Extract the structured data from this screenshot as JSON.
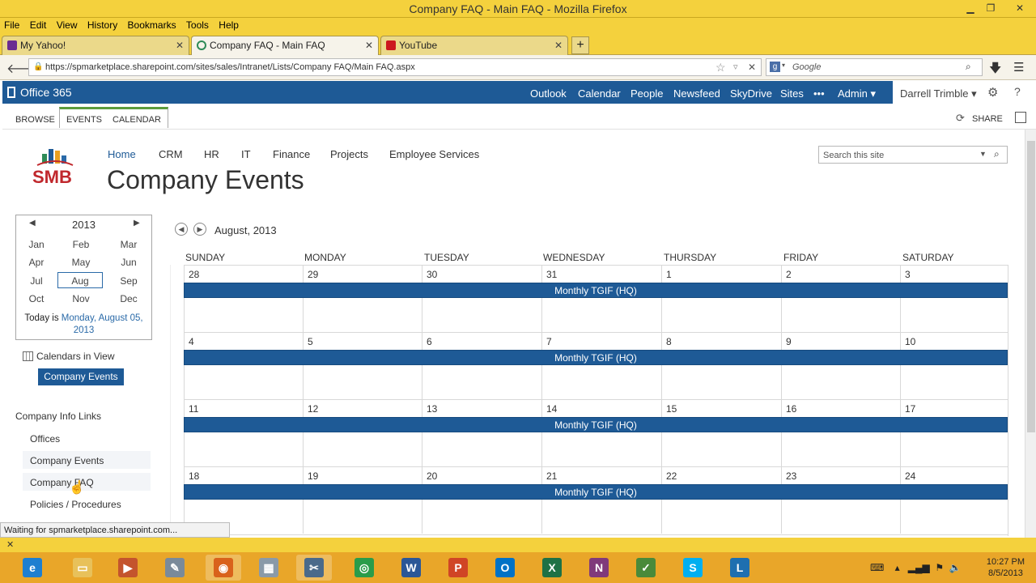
{
  "window": {
    "title": "Company FAQ - Main FAQ - Mozilla Firefox",
    "menu": [
      "File",
      "Edit",
      "View",
      "History",
      "Bookmarks",
      "Tools",
      "Help"
    ],
    "tabs": [
      {
        "label": "My Yahoo!",
        "favicon_color": "#6a2c91",
        "favicon_glyph": "Y!"
      },
      {
        "label": "Company FAQ - Main FAQ",
        "favicon_color": "#2e8b57",
        "favicon_glyph": "○"
      },
      {
        "label": "YouTube",
        "favicon_color": "#cc181e",
        "favicon_glyph": "▶"
      }
    ],
    "url": "https://spmarketplace.sharepoint.com/sites/sales/Intranet/Lists/Company FAQ/Main FAQ.aspx",
    "search_placeholder": "Google",
    "search_engine_glyph": "g"
  },
  "o365": {
    "brand": "Office 365",
    "nav": [
      "Outlook",
      "Calendar",
      "People",
      "Newsfeed",
      "SkyDrive",
      "Sites",
      "•••",
      "Admin ▾"
    ],
    "user": "Darrell Trimble ▾",
    "colors": {
      "bar": "#1e5a96",
      "accent_green": "#5c9c3c"
    }
  },
  "ribbon": {
    "tabs": [
      "BROWSE",
      "EVENTS",
      "CALENDAR"
    ],
    "share": "SHARE"
  },
  "site": {
    "logo_text": "SMB",
    "topnav": [
      "Home",
      "CRM",
      "HR",
      "IT",
      "Finance",
      "Projects",
      "Employee Services"
    ],
    "title": "Company Events",
    "search_placeholder": "Search this site"
  },
  "picker": {
    "year": "2013",
    "months": [
      "Jan",
      "Feb",
      "Mar",
      "Apr",
      "May",
      "Jun",
      "Jul",
      "Aug",
      "Sep",
      "Oct",
      "Nov",
      "Dec"
    ],
    "selected": "Aug",
    "today_prefix": "Today is",
    "today_link": "Monday, August 05,",
    "today_link2": "2013"
  },
  "calendars_in_view": {
    "label": "Calendars in View",
    "button": "Company Events"
  },
  "quicklaunch": {
    "heading": "Company Info Links",
    "items": [
      "Offices",
      "Company Events",
      "Company FAQ",
      "Policies / Procedures"
    ]
  },
  "calendar": {
    "month_label": "August, 2013",
    "days": [
      "SUNDAY",
      "MONDAY",
      "TUESDAY",
      "WEDNESDAY",
      "THURSDAY",
      "FRIDAY",
      "SATURDAY"
    ],
    "weeks": [
      [
        "28",
        "29",
        "30",
        "31",
        "1",
        "2",
        "3"
      ],
      [
        "4",
        "5",
        "6",
        "7",
        "8",
        "9",
        "10"
      ],
      [
        "11",
        "12",
        "13",
        "14",
        "15",
        "16",
        "17"
      ],
      [
        "18",
        "19",
        "20",
        "21",
        "22",
        "23",
        "24"
      ]
    ],
    "event": "Monthly TGIF (HQ)"
  },
  "status": "Waiting for spmarketplace.sharepoint.com...",
  "taskbar": {
    "apps": [
      {
        "name": "ie-icon",
        "color": "#1e7fd0",
        "glyph": "e"
      },
      {
        "name": "file-explorer-icon",
        "color": "#e8c15a",
        "glyph": "▭"
      },
      {
        "name": "media-player-icon",
        "color": "#c4542d",
        "glyph": "▶"
      },
      {
        "name": "notepad-icon",
        "color": "#7a8a9a",
        "glyph": "✎"
      },
      {
        "name": "firefox-icon",
        "color": "#d9621b",
        "glyph": "◉"
      },
      {
        "name": "calculator-icon",
        "color": "#8a9aa8",
        "glyph": "▦"
      },
      {
        "name": "snipping-tool-icon",
        "color": "#4a6a8a",
        "glyph": "✂"
      },
      {
        "name": "chrome-icon",
        "color": "#2a9c4a",
        "glyph": "◎"
      },
      {
        "name": "word-icon",
        "color": "#2b5797",
        "glyph": "W"
      },
      {
        "name": "powerpoint-icon",
        "color": "#d04525",
        "glyph": "P"
      },
      {
        "name": "outlook-icon",
        "color": "#0072c6",
        "glyph": "O"
      },
      {
        "name": "excel-icon",
        "color": "#1e7145",
        "glyph": "X"
      },
      {
        "name": "onenote-icon",
        "color": "#80397b",
        "glyph": "N"
      },
      {
        "name": "project-icon",
        "color": "#4a8a3a",
        "glyph": "✓"
      },
      {
        "name": "skype-icon",
        "color": "#00aff0",
        "glyph": "S"
      },
      {
        "name": "lync-icon",
        "color": "#1e6fb0",
        "glyph": "L"
      }
    ],
    "time": "10:27 PM",
    "date": "8/5/2013"
  }
}
